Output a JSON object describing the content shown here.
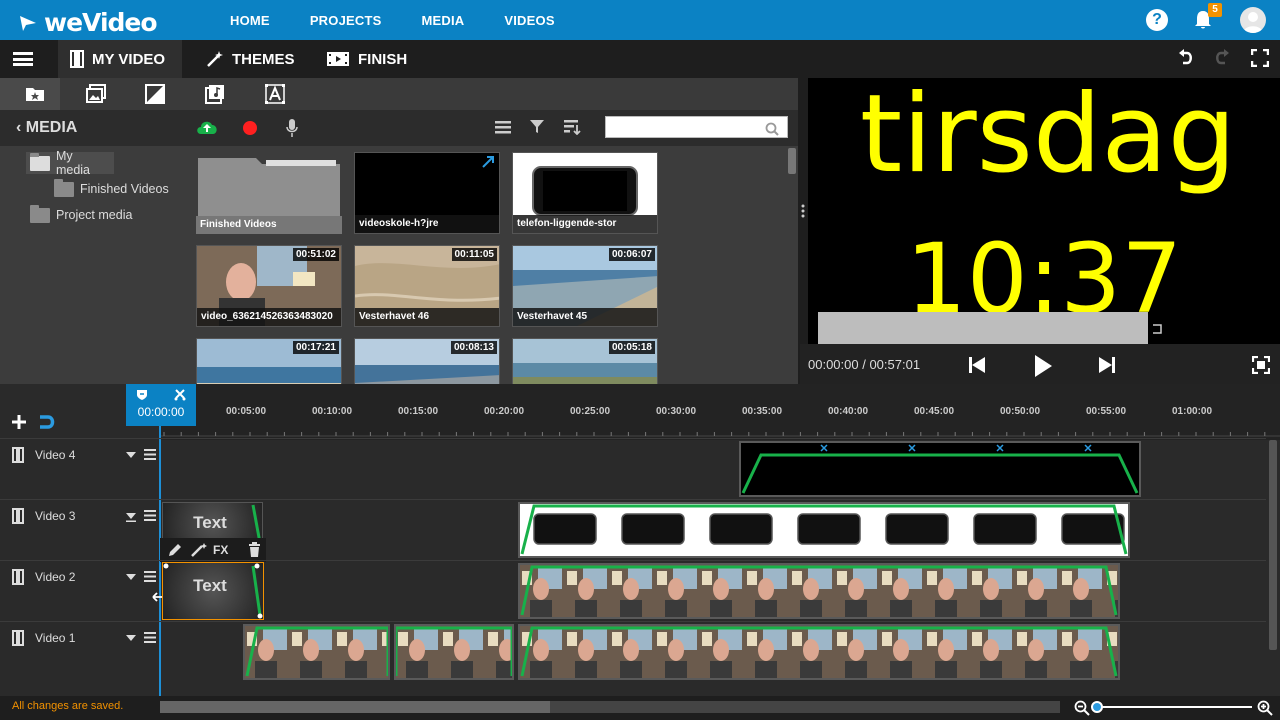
{
  "app": {
    "logo": "weVideo"
  },
  "topnav": [
    "HOME",
    "PROJECTS",
    "MEDIA",
    "VIDEOS"
  ],
  "notifications": {
    "count": "5"
  },
  "help_label": "?",
  "tabs": {
    "my_video": "MY VIDEO",
    "themes": "THEMES",
    "finish": "FINISH"
  },
  "media": {
    "title": "MEDIA",
    "search_placeholder": "",
    "folders": [
      {
        "label": "My media"
      },
      {
        "label": "Finished Videos"
      },
      {
        "label": "Project media"
      }
    ],
    "items": [
      {
        "label": "Finished Videos",
        "duration": ""
      },
      {
        "label": "videoskole-h?jre",
        "duration": ""
      },
      {
        "label": "telefon-liggende-stor",
        "duration": ""
      },
      {
        "label": "video_636214526363483020",
        "duration": "00:51:02"
      },
      {
        "label": "Vesterhavet 46",
        "duration": "00:11:05"
      },
      {
        "label": "Vesterhavet 45",
        "duration": "00:06:07"
      },
      {
        "label": "",
        "duration": "00:17:21"
      },
      {
        "label": "",
        "duration": "00:08:13"
      },
      {
        "label": "",
        "duration": "00:05:18"
      }
    ]
  },
  "preview": {
    "line1": "tirsdag",
    "line2": "10:37",
    "time": "00:00:00 / 00:57:01"
  },
  "timeline": {
    "playhead_time": "00:00:00",
    "ticks": [
      "00:05:00",
      "00:10:00",
      "00:15:00",
      "00:20:00",
      "00:25:00",
      "00:30:00",
      "00:35:00",
      "00:40:00",
      "00:45:00",
      "00:50:00",
      "00:55:00",
      "01:00:00"
    ],
    "tracks": [
      {
        "name": "Video 4"
      },
      {
        "name": "Video 3"
      },
      {
        "name": "Video 2"
      },
      {
        "name": "Video 1"
      }
    ],
    "text_clip_label": "Text",
    "fx_label": "FX"
  },
  "status": {
    "saved": "All changes are saved."
  },
  "colors": {
    "brand": "#0b82c4",
    "accent": "#f39200",
    "preview_text": "#ffff00",
    "trim": "#18b14a"
  }
}
